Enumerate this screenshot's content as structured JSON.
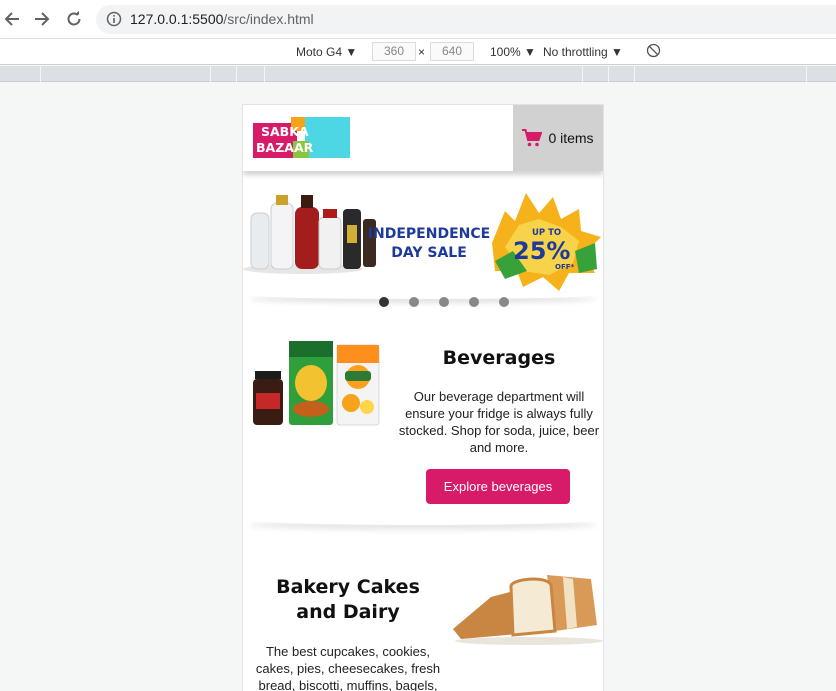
{
  "browser": {
    "url_host": "127.0.0.1:5500",
    "url_path": "/src/index.html"
  },
  "device_toolbar": {
    "device": "Moto G4",
    "width": "360",
    "height": "640",
    "times": "×",
    "zoom": "100%",
    "throttling": "No throttling"
  },
  "header": {
    "logo_line1": "SABKA",
    "logo_line2": "BAZAAR",
    "cart_label": "0 items"
  },
  "banner": {
    "line1": "INDEPENDENCE",
    "line2": "DAY SALE",
    "upto": "UP TO",
    "percent": "25%",
    "off": "OFF*",
    "active_slide": 1,
    "slides": 5
  },
  "categories": [
    {
      "title": "Beverages",
      "description": "Our beverage department will ensure your fridge is always fully stocked. Shop for soda, juice, beer and more.",
      "button": "Explore beverages"
    },
    {
      "title": "Bakery Cakes and Dairy",
      "description": "The best cupcakes, cookies, cakes, pies, cheesecakes, fresh bread, biscotti, muffins, bagels,"
    }
  ],
  "colors": {
    "brand": "#d81b68",
    "cart_bg": "#d1d1d1",
    "logo_red": "#d81b68",
    "logo_cyan": "#4dd6e4"
  },
  "icons": [
    "back-icon",
    "forward-icon",
    "reload-icon",
    "info-icon",
    "cart-icon",
    "rotate-icon"
  ]
}
